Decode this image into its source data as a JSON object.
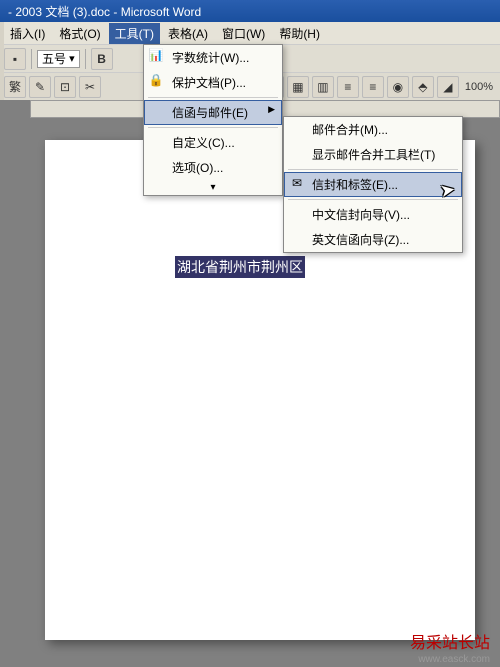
{
  "title": "- 2003 文档 (3).doc - Microsoft Word",
  "menubar": {
    "insert": "插入(I)",
    "format": "格式(O)",
    "tools": "工具(T)",
    "table": "表格(A)",
    "window": "窗口(W)",
    "help": "帮助(H)"
  },
  "toolbar": {
    "font_size": "五号",
    "zoom": "100%",
    "fan_char": "繁"
  },
  "tools_menu": {
    "word_count": "字数统计(W)...",
    "protect": "保护文档(P)...",
    "letters_mail": "信函与邮件(E)",
    "customize": "自定义(C)...",
    "options": "选项(O)..."
  },
  "letters_submenu": {
    "mail_merge": "邮件合并(M)...",
    "show_toolbar": "显示邮件合并工具栏(T)",
    "envelopes_labels": "信封和标签(E)...",
    "chinese_wizard": "中文信封向导(V)...",
    "english_wizard": "英文信函向导(Z)..."
  },
  "document": {
    "selected_text": "湖北省荆州市荆州区"
  },
  "watermark": {
    "text": "易采站长站",
    "url": "www.easck.com"
  }
}
